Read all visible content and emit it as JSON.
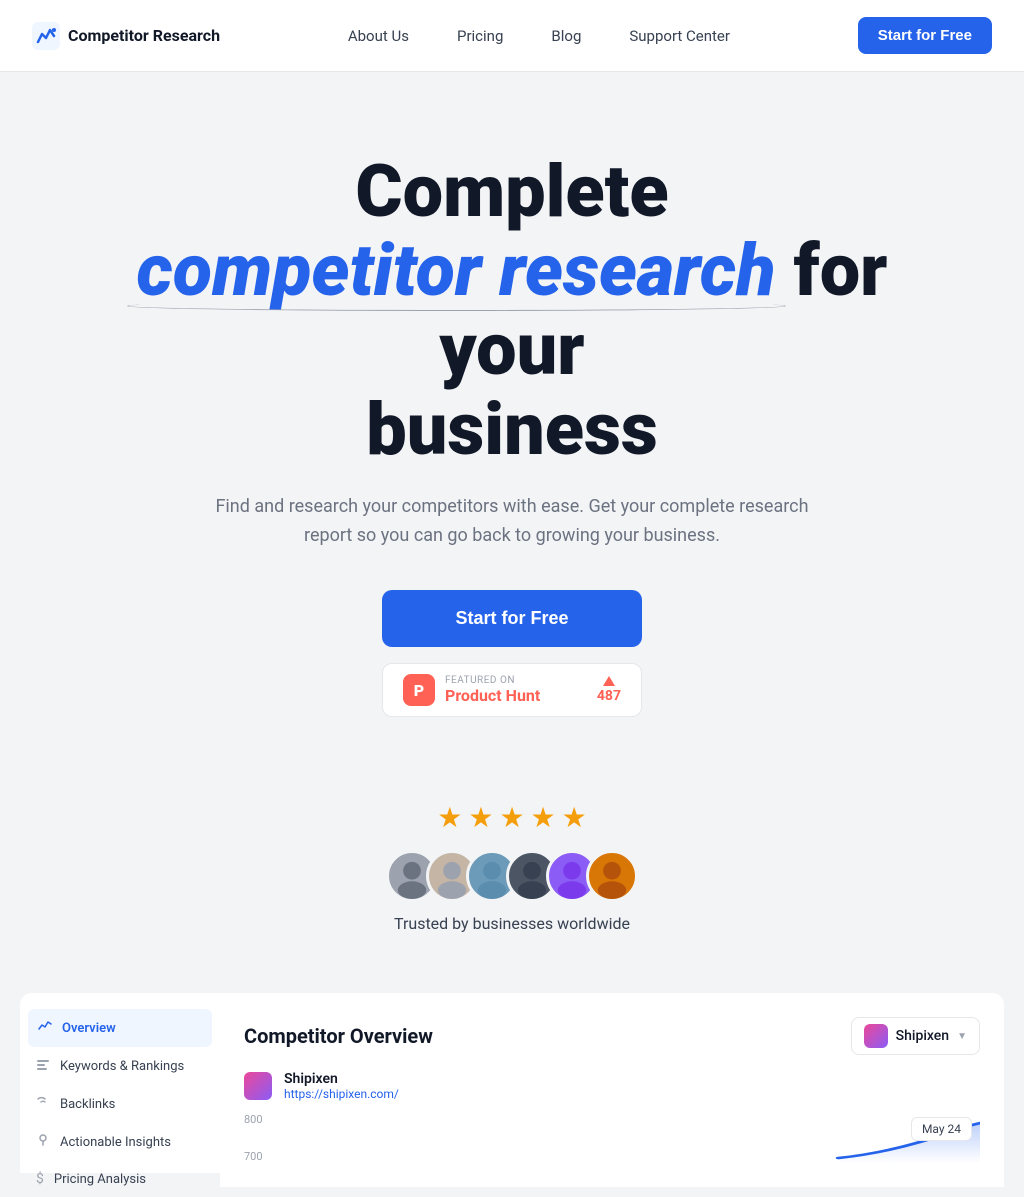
{
  "nav": {
    "logo_text": "Competitor Research",
    "links": [
      {
        "label": "About Us",
        "id": "about-us"
      },
      {
        "label": "Pricing",
        "id": "pricing"
      },
      {
        "label": "Blog",
        "id": "blog"
      },
      {
        "label": "Support Center",
        "id": "support-center"
      }
    ],
    "cta_label": "Start for Free"
  },
  "hero": {
    "title_prefix": "Complete",
    "title_highlight": "competitor research",
    "title_suffix": "for your business",
    "subtitle": "Find and research your competitors with ease. Get your complete research report so you can go back to growing your business.",
    "cta_label": "Start for Free",
    "product_hunt": {
      "featured_on": "FEATURED ON",
      "name": "Product Hunt",
      "votes": "487"
    }
  },
  "social_proof": {
    "stars": [
      "★",
      "★",
      "★",
      "★",
      "★"
    ],
    "trusted_text": "Trusted by businesses worldwide"
  },
  "preview": {
    "sidebar_items": [
      {
        "label": "Overview",
        "active": true,
        "icon": "📊"
      },
      {
        "label": "Keywords & Rankings",
        "active": false,
        "icon": "📈"
      },
      {
        "label": "Backlinks",
        "active": false,
        "icon": "🔗"
      },
      {
        "label": "Actionable Insights",
        "active": false,
        "icon": "💡"
      },
      {
        "label": "Pricing Analysis",
        "active": false,
        "icon": "💲"
      }
    ],
    "main_title": "Competitor Overview",
    "company_name": "Shipixen",
    "competitor": {
      "name": "Shipixen",
      "url": "https://shipixen.com/"
    },
    "chart_y_labels": [
      "800",
      "700"
    ],
    "date_badge": "May 24"
  }
}
